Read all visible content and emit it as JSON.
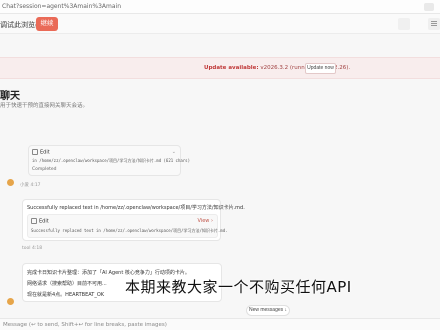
{
  "browser": {
    "url": "Chat?session=agent%3Amain%3Amain"
  },
  "tabbar": {
    "label": "调试此浏览器",
    "continue_label": "继续"
  },
  "update_banner": {
    "available_label": "Update available:",
    "detail": "v2026.3.2 (running v2026.2.26).",
    "button_label": "Update now"
  },
  "page": {
    "title": "聊天",
    "subtitle": "用于快速干预的直接网关聊天会话。"
  },
  "messages": [
    {
      "tool": {
        "name": "Edit",
        "path": "in /home/zz/.openclaw/workspace/项目/学习方法/知识卡片.md (621 chars)",
        "status": "Completed"
      },
      "sender": "小爱",
      "time": "4:17"
    },
    {
      "text": "Successfully replaced text in /home/zz/.openclaw/workspace/项目/学习方法/知识卡片.md.",
      "tool": {
        "name": "Edit",
        "view_label": "View",
        "path": "Successfully replaced text in /home/zz/.openclaw/workspace/项目/学习方法/知识卡片.md."
      },
      "sender": "tool",
      "time": "4:18"
    },
    {
      "lines": [
        "完成卡日知识卡片整理：添加了「AI Agent 核心竞争力」行动项的卡片。",
        "网络请求（搜索帮助）目前不可用...",
        "现在就是新4点。HEARTBEAT_OK"
      ]
    }
  ],
  "overlay_subtitle": "本期来教大家一个不购买任何API",
  "new_messages_label": "New messages",
  "composer": {
    "placeholder": "Message (↩ to send, Shift+↩ for line breaks, paste images)"
  },
  "colors": {
    "accent": "#ea6a57",
    "banner_bg": "#f8eded",
    "avatar": "#e6a54a"
  }
}
